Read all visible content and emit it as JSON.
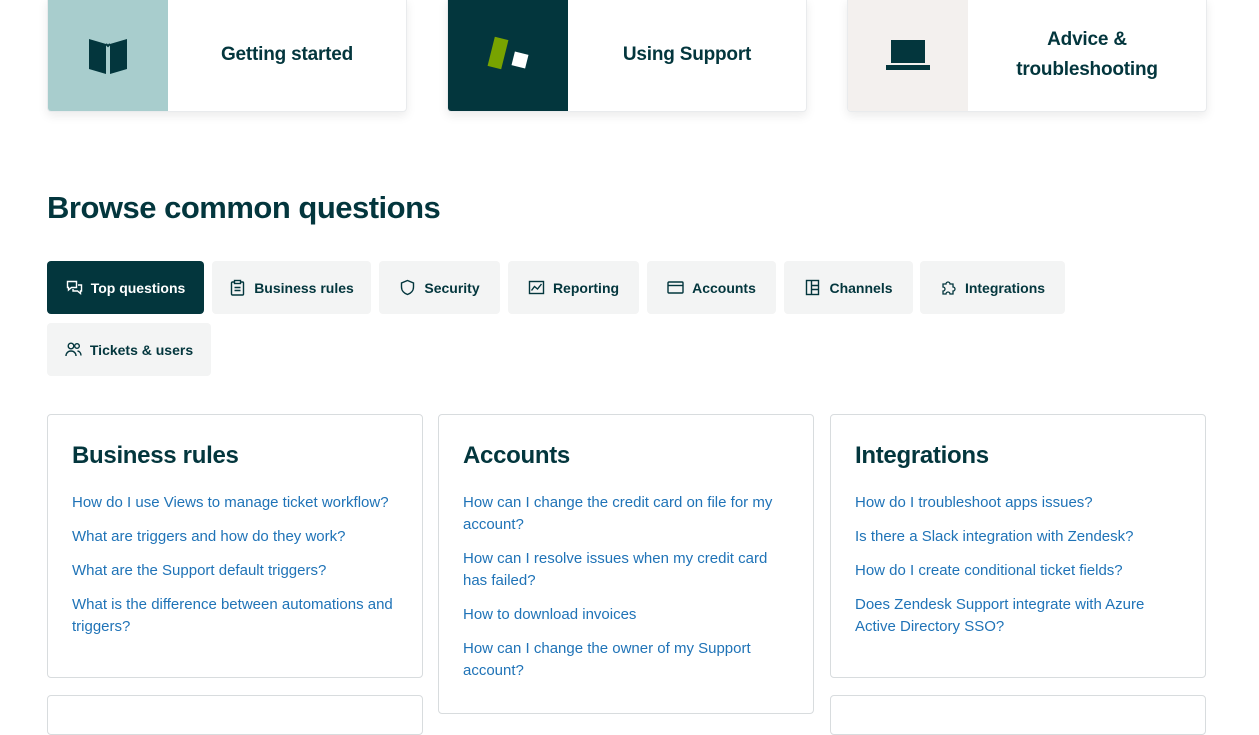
{
  "category_cards": [
    {
      "label": "Getting started",
      "icon": "book-icon",
      "color": "#a8cdcd"
    },
    {
      "label": "Using Support",
      "icon": "support-blocks-icon",
      "color": "#03363d"
    },
    {
      "label": "Advice & troubleshooting",
      "icon": "laptop-icon",
      "color": "#f3f0ee"
    }
  ],
  "browse": {
    "title": "Browse common questions",
    "tabs": [
      {
        "label": "Top questions",
        "icon": "chat-icon",
        "active": true
      },
      {
        "label": "Business rules",
        "icon": "clipboard-icon"
      },
      {
        "label": "Security",
        "icon": "shield-icon"
      },
      {
        "label": "Reporting",
        "icon": "chart-icon"
      },
      {
        "label": "Accounts",
        "icon": "credit-card-icon"
      },
      {
        "label": "Channels",
        "icon": "channels-icon"
      },
      {
        "label": "Integrations",
        "icon": "puzzle-icon"
      },
      {
        "label": "Tickets & users",
        "icon": "users-icon"
      }
    ]
  },
  "question_cards": [
    {
      "title": "Business rules",
      "links": [
        "How do I use Views to manage ticket workflow?",
        "What are triggers and how do they work?",
        "What are the Support default triggers?",
        "What is the difference between automations and triggers?"
      ]
    },
    {
      "title": "Accounts",
      "links": [
        "How can I change the credit card on file for my account?",
        "How can I resolve issues when my credit card has failed?",
        "How to download invoices",
        "How can I change the owner of my Support account?"
      ]
    },
    {
      "title": "Integrations",
      "links": [
        "How do I troubleshoot apps issues?",
        "Is there a Slack integration with Zendesk?",
        "How do I create conditional ticket fields?",
        "Does Zendesk Support integrate with Azure Active Directory SSO?"
      ]
    }
  ],
  "colors": {
    "primary": "#03363d",
    "link": "#1f73b7",
    "tab_bg": "#f3f4f4",
    "accent_green": "#78a300"
  }
}
